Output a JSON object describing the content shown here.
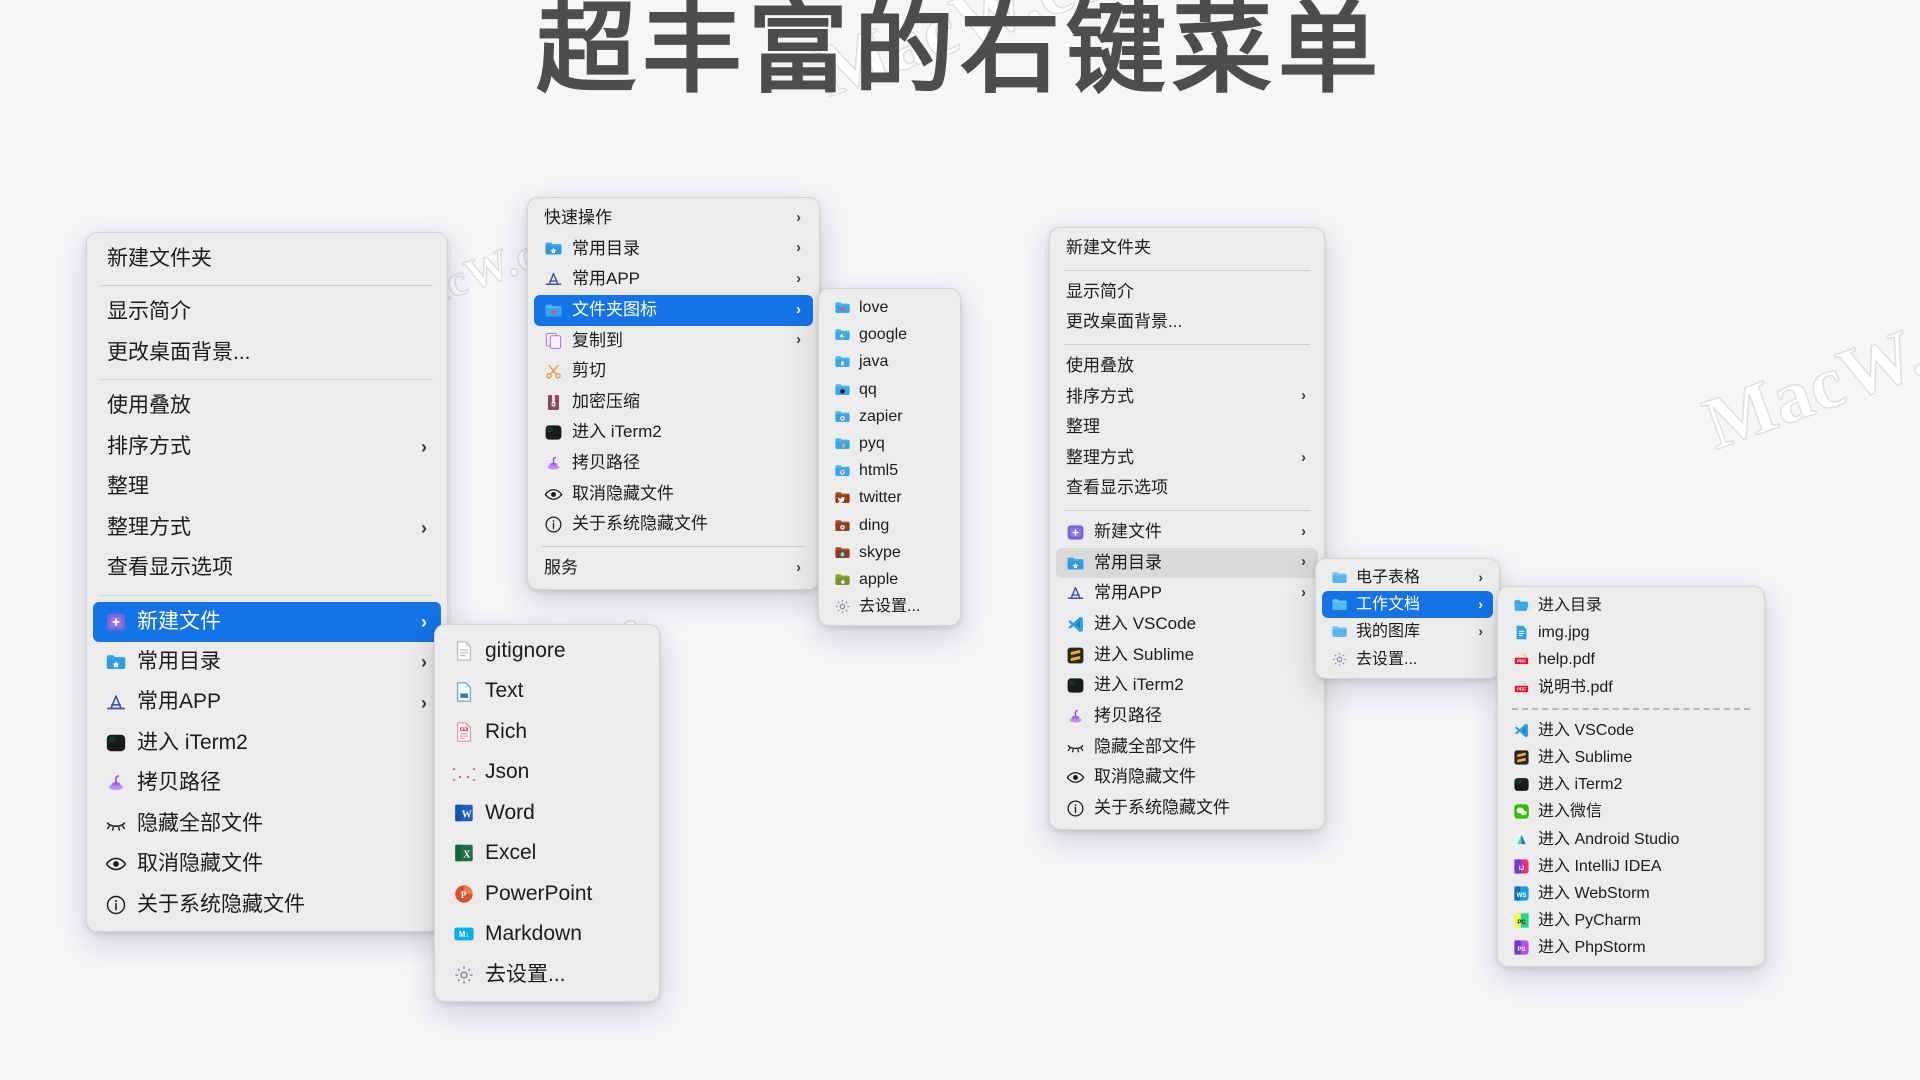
{
  "page": {
    "title": "超丰富的右键菜单",
    "background_color": "#f7f5f8",
    "accent_color": "#1473e6",
    "watermarks": [
      "MacW.com",
      "MacW.com",
      "MacW.c",
      "MacW.co"
    ]
  },
  "menu_desktop": {
    "name": "desktop-context-menu",
    "items": [
      {
        "label": "新建文件夹",
        "icon": null,
        "arrow": false,
        "state": "normal"
      },
      {
        "type": "separator"
      },
      {
        "label": "显示简介",
        "icon": null,
        "arrow": false,
        "state": "normal"
      },
      {
        "label": "更改桌面背景...",
        "icon": null,
        "arrow": false,
        "state": "normal"
      },
      {
        "type": "separator"
      },
      {
        "label": "使用叠放",
        "icon": null,
        "arrow": false,
        "state": "normal"
      },
      {
        "label": "排序方式",
        "icon": null,
        "arrow": true,
        "state": "normal"
      },
      {
        "label": "整理",
        "icon": null,
        "arrow": false,
        "state": "normal"
      },
      {
        "label": "整理方式",
        "icon": null,
        "arrow": true,
        "state": "normal"
      },
      {
        "label": "查看显示选项",
        "icon": null,
        "arrow": false,
        "state": "normal"
      },
      {
        "type": "separator"
      },
      {
        "label": "新建文件",
        "icon": "new-file-icon",
        "arrow": true,
        "state": "selected"
      },
      {
        "label": "常用目录",
        "icon": "star-folder-icon",
        "arrow": true,
        "state": "normal"
      },
      {
        "label": "常用APP",
        "icon": "appstore-icon",
        "arrow": true,
        "state": "normal"
      },
      {
        "label": "进入 iTerm2",
        "icon": "iterm2-icon",
        "arrow": false,
        "state": "normal"
      },
      {
        "label": "拷贝路径",
        "icon": "copy-path-icon",
        "arrow": false,
        "state": "normal"
      },
      {
        "label": "隐藏全部文件",
        "icon": "eye-closed-icon",
        "arrow": false,
        "state": "normal"
      },
      {
        "label": "取消隐藏文件",
        "icon": "eye-open-icon",
        "arrow": false,
        "state": "normal"
      },
      {
        "label": "关于系统隐藏文件",
        "icon": "info-icon",
        "arrow": false,
        "state": "normal"
      }
    ]
  },
  "menu_quick": {
    "name": "quick-actions-menu",
    "items": [
      {
        "label": "快速操作",
        "icon": null,
        "arrow": true,
        "state": "normal"
      },
      {
        "label": "常用目录",
        "icon": "star-folder-icon",
        "arrow": true,
        "state": "normal"
      },
      {
        "label": "常用APP",
        "icon": "appstore-icon",
        "arrow": true,
        "state": "normal"
      },
      {
        "label": "文件夹图标",
        "icon": "folder-heart-icon",
        "arrow": true,
        "state": "selected"
      },
      {
        "label": "复制到",
        "icon": "copy-to-icon",
        "arrow": true,
        "state": "normal"
      },
      {
        "label": "剪切",
        "icon": "scissors-icon",
        "arrow": false,
        "state": "normal"
      },
      {
        "label": "加密压缩",
        "icon": "zip-lock-icon",
        "arrow": false,
        "state": "normal"
      },
      {
        "label": "进入 iTerm2",
        "icon": "iterm2-icon",
        "arrow": false,
        "state": "normal"
      },
      {
        "label": "拷贝路径",
        "icon": "copy-path-icon",
        "arrow": false,
        "state": "normal"
      },
      {
        "label": "取消隐藏文件",
        "icon": "eye-open-icon",
        "arrow": false,
        "state": "normal"
      },
      {
        "label": "关于系统隐藏文件",
        "icon": "info-icon",
        "arrow": false,
        "state": "normal"
      },
      {
        "type": "separator"
      },
      {
        "label": "服务",
        "icon": null,
        "arrow": true,
        "state": "normal"
      }
    ]
  },
  "menu_folder_icons": {
    "name": "folder-icon-submenu",
    "items": [
      {
        "label": "love",
        "icon": "folder-heart-icon",
        "arrow": false,
        "state": "normal"
      },
      {
        "label": "google",
        "icon": "folder-google-icon",
        "arrow": false,
        "state": "normal"
      },
      {
        "label": "java",
        "icon": "folder-java-icon",
        "arrow": false,
        "state": "normal"
      },
      {
        "label": "qq",
        "icon": "folder-qq-icon",
        "arrow": false,
        "state": "normal"
      },
      {
        "label": "zapier",
        "icon": "folder-zapier-icon",
        "arrow": false,
        "state": "normal"
      },
      {
        "label": "pyq",
        "icon": "folder-pyq-icon",
        "arrow": false,
        "state": "normal"
      },
      {
        "label": "html5",
        "icon": "folder-html5-icon",
        "arrow": false,
        "state": "normal"
      },
      {
        "label": "twitter",
        "icon": "folder-twitter-icon",
        "arrow": false,
        "state": "normal"
      },
      {
        "label": "ding",
        "icon": "folder-ding-icon",
        "arrow": false,
        "state": "normal"
      },
      {
        "label": "skype",
        "icon": "folder-skype-icon",
        "arrow": false,
        "state": "normal"
      },
      {
        "label": "apple",
        "icon": "folder-apple-icon",
        "arrow": false,
        "state": "normal"
      },
      {
        "label": "去设置...",
        "icon": "gear-icon",
        "arrow": false,
        "state": "normal"
      }
    ]
  },
  "menu_new_file": {
    "name": "new-file-submenu",
    "items": [
      {
        "label": "gitignore",
        "icon": "gitignore-icon",
        "arrow": false,
        "state": "normal"
      },
      {
        "label": "Text",
        "icon": "text-doc-icon",
        "arrow": false,
        "state": "normal"
      },
      {
        "label": "Rich",
        "icon": "rtf-doc-icon",
        "arrow": false,
        "state": "normal"
      },
      {
        "label": "Json",
        "icon": "json-icon",
        "arrow": false,
        "state": "normal"
      },
      {
        "label": "Word",
        "icon": "word-icon",
        "arrow": false,
        "state": "normal"
      },
      {
        "label": "Excel",
        "icon": "excel-icon",
        "arrow": false,
        "state": "normal"
      },
      {
        "label": "PowerPoint",
        "icon": "powerpoint-icon",
        "arrow": false,
        "state": "normal"
      },
      {
        "label": "Markdown",
        "icon": "markdown-icon",
        "arrow": false,
        "state": "normal"
      },
      {
        "label": "去设置...",
        "icon": "gear-icon",
        "arrow": false,
        "state": "normal"
      }
    ]
  },
  "menu_desktop_2": {
    "name": "desktop-context-menu-secondary",
    "items": [
      {
        "label": "新建文件夹",
        "icon": null,
        "arrow": false,
        "state": "normal"
      },
      {
        "type": "separator"
      },
      {
        "label": "显示简介",
        "icon": null,
        "arrow": false,
        "state": "normal"
      },
      {
        "label": "更改桌面背景...",
        "icon": null,
        "arrow": false,
        "state": "normal"
      },
      {
        "type": "separator"
      },
      {
        "label": "使用叠放",
        "icon": null,
        "arrow": false,
        "state": "normal"
      },
      {
        "label": "排序方式",
        "icon": null,
        "arrow": true,
        "state": "normal"
      },
      {
        "label": "整理",
        "icon": null,
        "arrow": false,
        "state": "normal"
      },
      {
        "label": "整理方式",
        "icon": null,
        "arrow": true,
        "state": "normal"
      },
      {
        "label": "查看显示选项",
        "icon": null,
        "arrow": false,
        "state": "normal"
      },
      {
        "type": "separator"
      },
      {
        "label": "新建文件",
        "icon": "new-file-icon",
        "arrow": true,
        "state": "normal"
      },
      {
        "label": "常用目录",
        "icon": "star-folder-icon",
        "arrow": true,
        "state": "hover"
      },
      {
        "label": "常用APP",
        "icon": "appstore-icon",
        "arrow": true,
        "state": "normal"
      },
      {
        "label": "进入 VSCode",
        "icon": "vscode-icon",
        "arrow": false,
        "state": "normal"
      },
      {
        "label": "进入 Sublime",
        "icon": "sublime-icon",
        "arrow": false,
        "state": "normal"
      },
      {
        "label": "进入 iTerm2",
        "icon": "iterm2-icon",
        "arrow": false,
        "state": "normal"
      },
      {
        "label": "拷贝路径",
        "icon": "copy-path-icon",
        "arrow": false,
        "state": "normal"
      },
      {
        "label": "隐藏全部文件",
        "icon": "eye-closed-icon",
        "arrow": false,
        "state": "normal"
      },
      {
        "label": "取消隐藏文件",
        "icon": "eye-open-icon",
        "arrow": false,
        "state": "normal"
      },
      {
        "label": "关于系统隐藏文件",
        "icon": "info-icon",
        "arrow": false,
        "state": "normal"
      }
    ]
  },
  "menu_dirs": {
    "name": "favorite-dirs-submenu",
    "items": [
      {
        "label": "电子表格",
        "icon": "folder-plain-icon",
        "arrow": true,
        "state": "normal"
      },
      {
        "label": "工作文档",
        "icon": "folder-plain-icon",
        "arrow": true,
        "state": "selected"
      },
      {
        "label": "我的图库",
        "icon": "folder-plain-icon",
        "arrow": true,
        "state": "normal"
      },
      {
        "label": "去设置...",
        "icon": "gear-icon",
        "arrow": false,
        "state": "normal"
      }
    ]
  },
  "menu_dir_contents": {
    "name": "work-docs-submenu",
    "items": [
      {
        "label": "进入目录",
        "icon": "open-folder-icon",
        "arrow": false,
        "state": "normal"
      },
      {
        "label": "img.jpg",
        "icon": "image-file-icon",
        "arrow": false,
        "state": "normal"
      },
      {
        "label": "help.pdf",
        "icon": "pdf-file-icon",
        "arrow": false,
        "state": "normal"
      },
      {
        "label": "说明书.pdf",
        "icon": "pdf-file-icon",
        "arrow": false,
        "state": "normal"
      },
      {
        "type": "separator-dashed"
      },
      {
        "label": "进入 VSCode",
        "icon": "vscode-icon",
        "arrow": false,
        "state": "normal"
      },
      {
        "label": "进入 Sublime",
        "icon": "sublime-icon",
        "arrow": false,
        "state": "normal"
      },
      {
        "label": "进入 iTerm2",
        "icon": "iterm2-icon",
        "arrow": false,
        "state": "normal"
      },
      {
        "label": "进入微信",
        "icon": "wechat-icon",
        "arrow": false,
        "state": "normal"
      },
      {
        "label": "进入 Android Studio",
        "icon": "android-studio-icon",
        "arrow": false,
        "state": "normal"
      },
      {
        "label": "进入 IntelliJ IDEA",
        "icon": "intellij-idea-icon",
        "arrow": false,
        "state": "normal"
      },
      {
        "label": "进入 WebStorm",
        "icon": "webstorm-icon",
        "arrow": false,
        "state": "normal"
      },
      {
        "label": "进入 PyCharm",
        "icon": "pycharm-icon",
        "arrow": false,
        "state": "normal"
      },
      {
        "label": "进入 PhpStorm",
        "icon": "phpstorm-icon",
        "arrow": false,
        "state": "normal"
      }
    ]
  }
}
